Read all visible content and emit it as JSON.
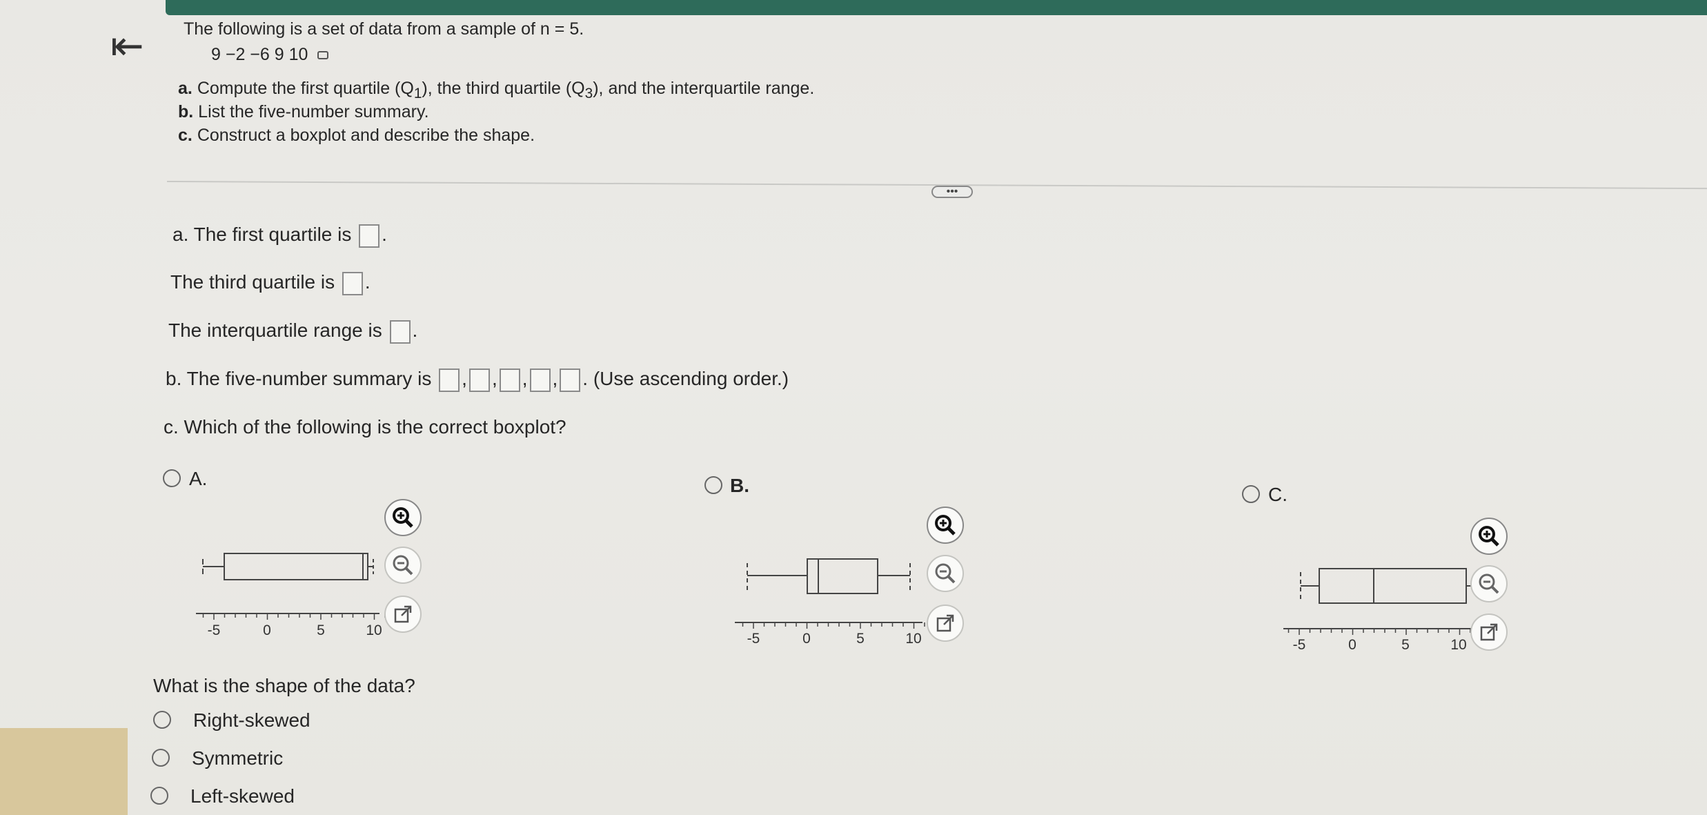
{
  "question": {
    "intro": "The following is a set of data from a sample of n = 5.",
    "data_values": "9  −2  −6  9  10",
    "part_a": {
      "letter": "a.",
      "text_pre": "Compute the first quartile (Q",
      "sub1": "1",
      "text_mid": "), the third quartile (Q",
      "sub3": "3",
      "text_post": "), and the interquartile range."
    },
    "part_b": {
      "letter": "b.",
      "text": "List the five-number summary."
    },
    "part_c": {
      "letter": "c.",
      "text": "Construct a boxplot and describe the shape."
    }
  },
  "answers": {
    "q1_label": "a. The first quartile is",
    "q3_label": "The third quartile is",
    "iqr_label": "The interquartile range is",
    "five_label": "b. The five-number summary is",
    "five_note": "(Use ascending order.)",
    "boxplot_question": "c. Which of the following is the correct boxplot?"
  },
  "options": [
    {
      "label": "A.",
      "axis_ticks": [
        "-5",
        "0",
        "5",
        "10"
      ]
    },
    {
      "label": "B.",
      "axis_ticks": [
        "-5",
        "0",
        "5",
        "10"
      ]
    },
    {
      "label": "C.",
      "axis_ticks": [
        "-5",
        "0",
        "5",
        "10"
      ]
    }
  ],
  "shape": {
    "question": "What is the shape of the data?",
    "choices": [
      "Right-skewed",
      "Symmetric",
      "Left-skewed"
    ]
  },
  "icons": {
    "back": "collapse-left-icon",
    "zoom_in": "zoom-in-icon",
    "zoom_out": "zoom-out-icon",
    "external": "open-external-icon",
    "copy": "copy-icon"
  }
}
